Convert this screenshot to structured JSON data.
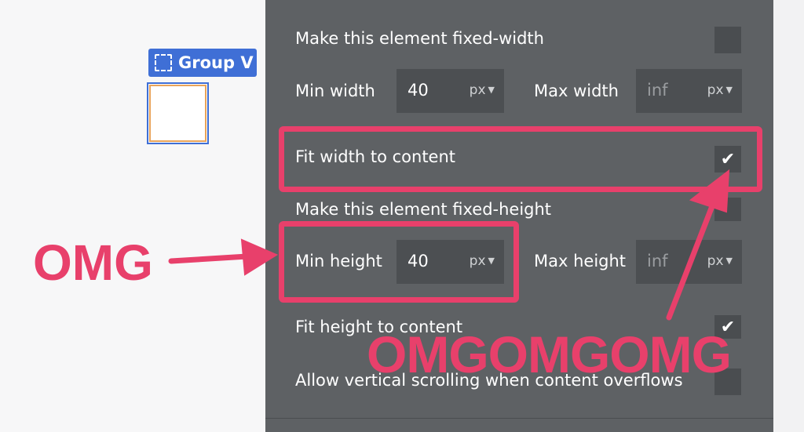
{
  "canvas": {
    "group_label": "Group V"
  },
  "panel": {
    "fixed_width_label": "Make this element fixed-width",
    "min_width_label": "Min width",
    "min_width_value": "40",
    "min_width_unit": "px",
    "max_width_label": "Max width",
    "max_width_value": "inf",
    "max_width_unit": "px",
    "fit_width_label": "Fit width to content",
    "fixed_height_label": "Make this element fixed-height",
    "min_height_label": "Min height",
    "min_height_value": "40",
    "min_height_unit": "px",
    "max_height_label": "Max height",
    "max_height_value": "inf",
    "max_height_unit": "px",
    "fit_height_label": "Fit height to content",
    "vertical_scroll_label": "Allow vertical scrolling when content overflows",
    "checkmark": "✔"
  },
  "annotations": {
    "omg_left": "OMG",
    "omg_right": "OMGOMGOMG"
  },
  "colors": {
    "accent": "#e8406b",
    "panel": "#5e6164",
    "group_blue": "#3f6fd6"
  }
}
